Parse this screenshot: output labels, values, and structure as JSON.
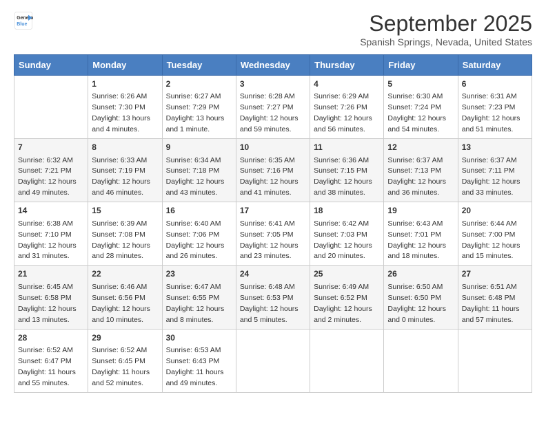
{
  "header": {
    "logo_line1": "General",
    "logo_line2": "Blue",
    "title": "September 2025",
    "subtitle": "Spanish Springs, Nevada, United States"
  },
  "days_of_week": [
    "Sunday",
    "Monday",
    "Tuesday",
    "Wednesday",
    "Thursday",
    "Friday",
    "Saturday"
  ],
  "weeks": [
    [
      {
        "day": "",
        "info": ""
      },
      {
        "day": "1",
        "info": "Sunrise: 6:26 AM\nSunset: 7:30 PM\nDaylight: 13 hours\nand 4 minutes."
      },
      {
        "day": "2",
        "info": "Sunrise: 6:27 AM\nSunset: 7:29 PM\nDaylight: 13 hours\nand 1 minute."
      },
      {
        "day": "3",
        "info": "Sunrise: 6:28 AM\nSunset: 7:27 PM\nDaylight: 12 hours\nand 59 minutes."
      },
      {
        "day": "4",
        "info": "Sunrise: 6:29 AM\nSunset: 7:26 PM\nDaylight: 12 hours\nand 56 minutes."
      },
      {
        "day": "5",
        "info": "Sunrise: 6:30 AM\nSunset: 7:24 PM\nDaylight: 12 hours\nand 54 minutes."
      },
      {
        "day": "6",
        "info": "Sunrise: 6:31 AM\nSunset: 7:23 PM\nDaylight: 12 hours\nand 51 minutes."
      }
    ],
    [
      {
        "day": "7",
        "info": "Sunrise: 6:32 AM\nSunset: 7:21 PM\nDaylight: 12 hours\nand 49 minutes."
      },
      {
        "day": "8",
        "info": "Sunrise: 6:33 AM\nSunset: 7:19 PM\nDaylight: 12 hours\nand 46 minutes."
      },
      {
        "day": "9",
        "info": "Sunrise: 6:34 AM\nSunset: 7:18 PM\nDaylight: 12 hours\nand 43 minutes."
      },
      {
        "day": "10",
        "info": "Sunrise: 6:35 AM\nSunset: 7:16 PM\nDaylight: 12 hours\nand 41 minutes."
      },
      {
        "day": "11",
        "info": "Sunrise: 6:36 AM\nSunset: 7:15 PM\nDaylight: 12 hours\nand 38 minutes."
      },
      {
        "day": "12",
        "info": "Sunrise: 6:37 AM\nSunset: 7:13 PM\nDaylight: 12 hours\nand 36 minutes."
      },
      {
        "day": "13",
        "info": "Sunrise: 6:37 AM\nSunset: 7:11 PM\nDaylight: 12 hours\nand 33 minutes."
      }
    ],
    [
      {
        "day": "14",
        "info": "Sunrise: 6:38 AM\nSunset: 7:10 PM\nDaylight: 12 hours\nand 31 minutes."
      },
      {
        "day": "15",
        "info": "Sunrise: 6:39 AM\nSunset: 7:08 PM\nDaylight: 12 hours\nand 28 minutes."
      },
      {
        "day": "16",
        "info": "Sunrise: 6:40 AM\nSunset: 7:06 PM\nDaylight: 12 hours\nand 26 minutes."
      },
      {
        "day": "17",
        "info": "Sunrise: 6:41 AM\nSunset: 7:05 PM\nDaylight: 12 hours\nand 23 minutes."
      },
      {
        "day": "18",
        "info": "Sunrise: 6:42 AM\nSunset: 7:03 PM\nDaylight: 12 hours\nand 20 minutes."
      },
      {
        "day": "19",
        "info": "Sunrise: 6:43 AM\nSunset: 7:01 PM\nDaylight: 12 hours\nand 18 minutes."
      },
      {
        "day": "20",
        "info": "Sunrise: 6:44 AM\nSunset: 7:00 PM\nDaylight: 12 hours\nand 15 minutes."
      }
    ],
    [
      {
        "day": "21",
        "info": "Sunrise: 6:45 AM\nSunset: 6:58 PM\nDaylight: 12 hours\nand 13 minutes."
      },
      {
        "day": "22",
        "info": "Sunrise: 6:46 AM\nSunset: 6:56 PM\nDaylight: 12 hours\nand 10 minutes."
      },
      {
        "day": "23",
        "info": "Sunrise: 6:47 AM\nSunset: 6:55 PM\nDaylight: 12 hours\nand 8 minutes."
      },
      {
        "day": "24",
        "info": "Sunrise: 6:48 AM\nSunset: 6:53 PM\nDaylight: 12 hours\nand 5 minutes."
      },
      {
        "day": "25",
        "info": "Sunrise: 6:49 AM\nSunset: 6:52 PM\nDaylight: 12 hours\nand 2 minutes."
      },
      {
        "day": "26",
        "info": "Sunrise: 6:50 AM\nSunset: 6:50 PM\nDaylight: 12 hours\nand 0 minutes."
      },
      {
        "day": "27",
        "info": "Sunrise: 6:51 AM\nSunset: 6:48 PM\nDaylight: 11 hours\nand 57 minutes."
      }
    ],
    [
      {
        "day": "28",
        "info": "Sunrise: 6:52 AM\nSunset: 6:47 PM\nDaylight: 11 hours\nand 55 minutes."
      },
      {
        "day": "29",
        "info": "Sunrise: 6:52 AM\nSunset: 6:45 PM\nDaylight: 11 hours\nand 52 minutes."
      },
      {
        "day": "30",
        "info": "Sunrise: 6:53 AM\nSunset: 6:43 PM\nDaylight: 11 hours\nand 49 minutes."
      },
      {
        "day": "",
        "info": ""
      },
      {
        "day": "",
        "info": ""
      },
      {
        "day": "",
        "info": ""
      },
      {
        "day": "",
        "info": ""
      }
    ]
  ]
}
